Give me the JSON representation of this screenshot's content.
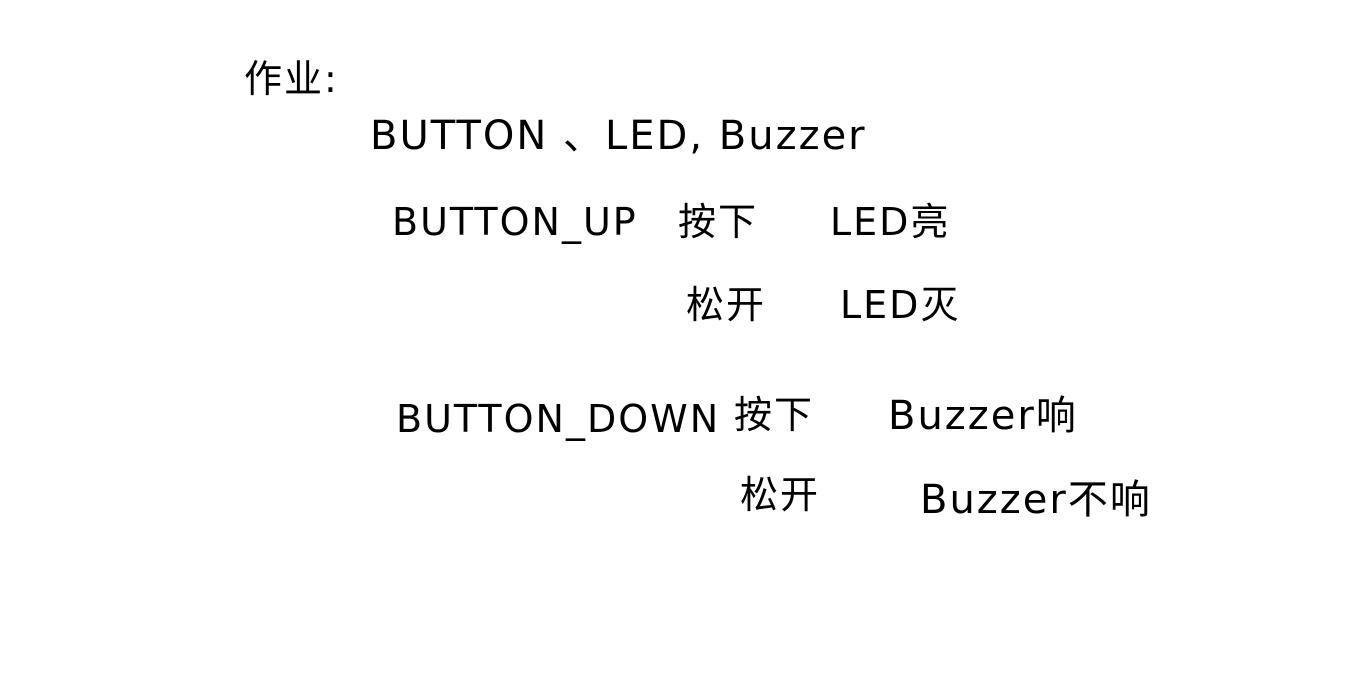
{
  "note": {
    "title": "作业:",
    "components": "BUTTON 、LED, Buzzer",
    "button_up": {
      "name": "BUTTON_UP",
      "press": "按下",
      "press_result": "LED亮",
      "release": "松开",
      "release_result": "LED灭"
    },
    "button_down": {
      "name": "BUTTON_DOWN",
      "press": "按下",
      "press_result": "Buzzer响",
      "release": "松开",
      "release_result": "Buzzer不响"
    }
  },
  "colors": {
    "background": "#ffffff",
    "ink": "#000000"
  }
}
